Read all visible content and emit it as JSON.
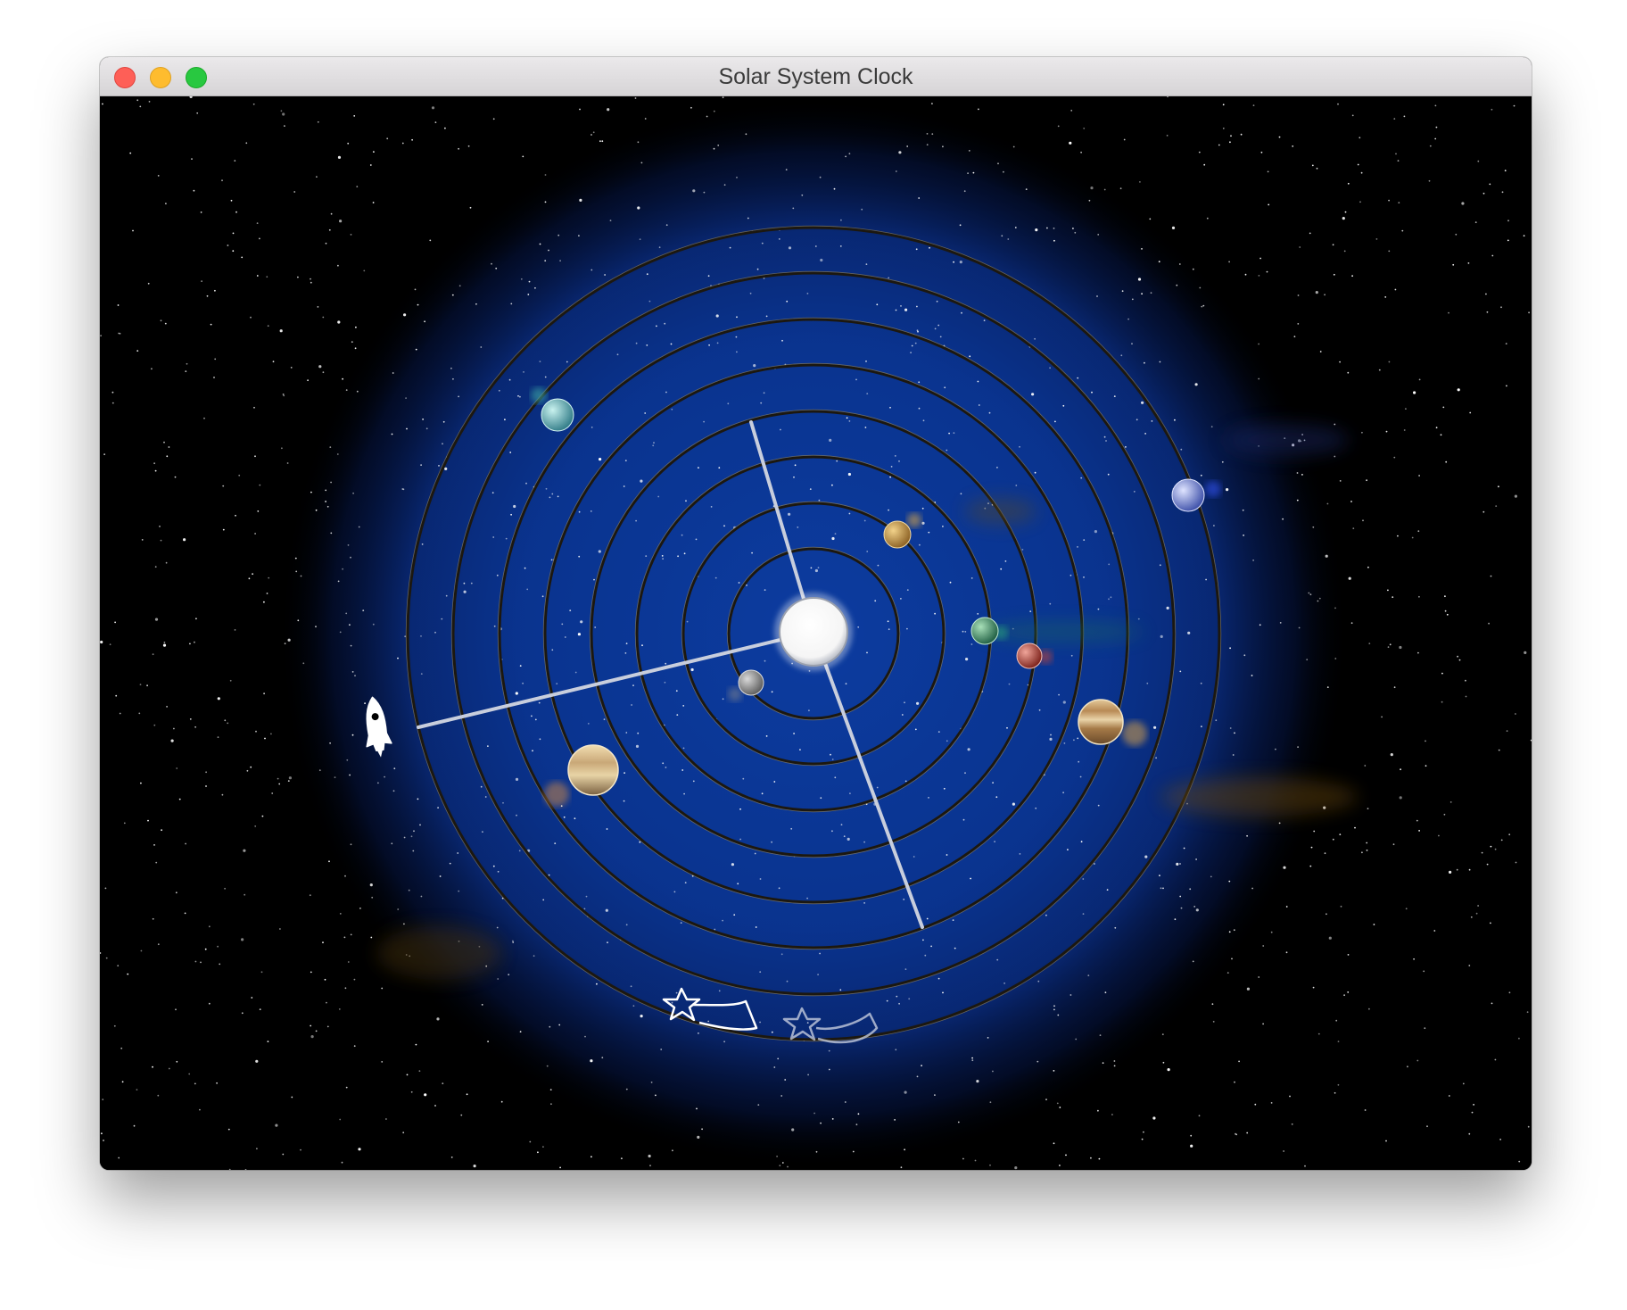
{
  "window": {
    "title": "Solar System Clock"
  },
  "colors": {
    "space": "#000000",
    "nebula_core": "#0b3b9e",
    "orbit_line": "#1c1810",
    "orbit_highlight": "#9c8a5c",
    "clock_hand": "#c9cfe0",
    "sun": "#ffffff"
  },
  "clock": {
    "hour_hand_label": "hour-hand",
    "minute_hand_label": "minute-hand",
    "second_hand_label": "second-hand"
  },
  "planets": [
    {
      "name": "mercury",
      "color": "#8c8c8c"
    },
    {
      "name": "venus",
      "color": "#d8a64a"
    },
    {
      "name": "earth",
      "color": "#3a9a6b"
    },
    {
      "name": "mars",
      "color": "#c0443a"
    },
    {
      "name": "jupiter",
      "color": "#c9a46a"
    },
    {
      "name": "saturn",
      "color": "#c8a878"
    },
    {
      "name": "uranus",
      "color": "#6ec6c9"
    },
    {
      "name": "neptune",
      "color": "#7d8ed8"
    }
  ],
  "icons": {
    "rocket": "rocket-icon",
    "shooting_star_1": "shooting-star-icon",
    "shooting_star_2": "shooting-star-icon"
  }
}
